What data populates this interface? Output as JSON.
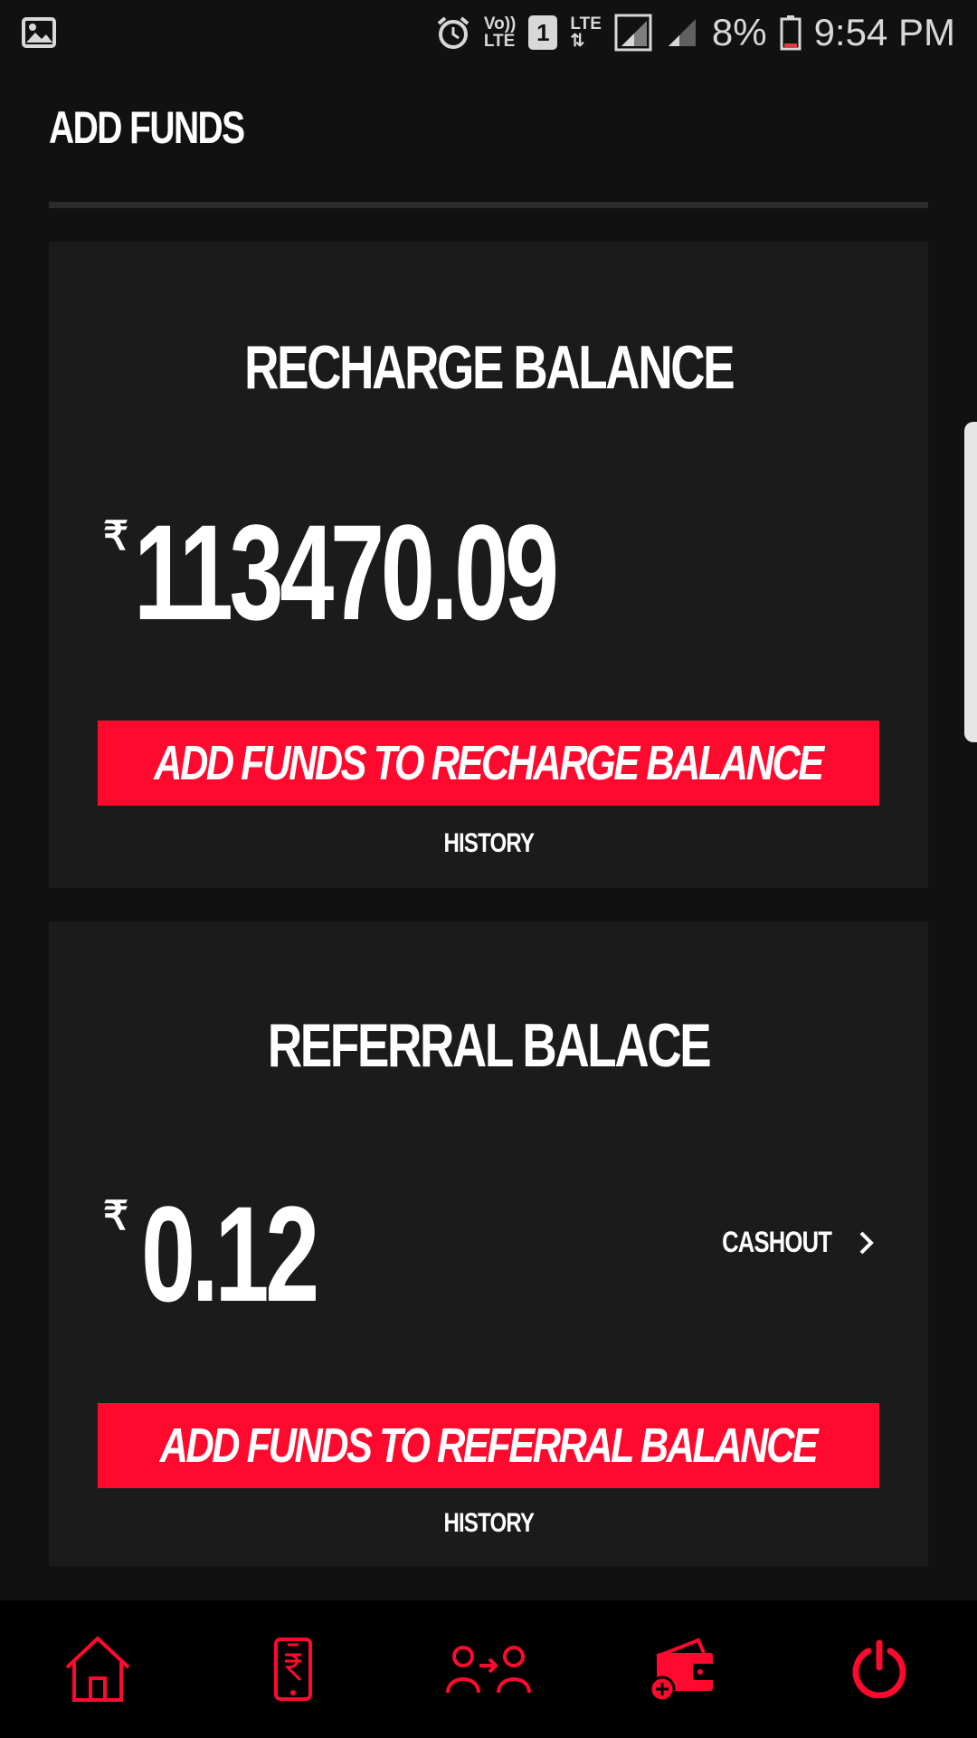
{
  "status_bar": {
    "volte_top": "Vo))",
    "volte_bottom": "LTE",
    "sim": "1",
    "lte": "LTE",
    "battery": "8%",
    "time": "9:54 PM"
  },
  "header": {
    "title": "ADD FUNDS"
  },
  "recharge": {
    "title": "RECHARGE BALANCE",
    "currency": "₹",
    "amount": "113470.09",
    "button_label": "ADD FUNDS TO RECHARGE BALANCE",
    "history_label": "HISTORY"
  },
  "referral": {
    "title": "REFERRAL BALACE",
    "currency": "₹",
    "amount": "0.12",
    "cashout_label": "CASHOUT",
    "button_label": "ADD FUNDS TO REFERRAL BALANCE",
    "history_label": "HISTORY"
  },
  "bottom_nav": {
    "items": [
      {
        "icon": "home-icon"
      },
      {
        "icon": "mobile-recharge-icon"
      },
      {
        "icon": "transfer-users-icon"
      },
      {
        "icon": "add-wallet-icon"
      },
      {
        "icon": "power-icon"
      }
    ]
  },
  "colors": {
    "accent": "#ff0a2e",
    "background": "#111111",
    "card": "#1b1b1b",
    "nav_background": "#000000"
  }
}
